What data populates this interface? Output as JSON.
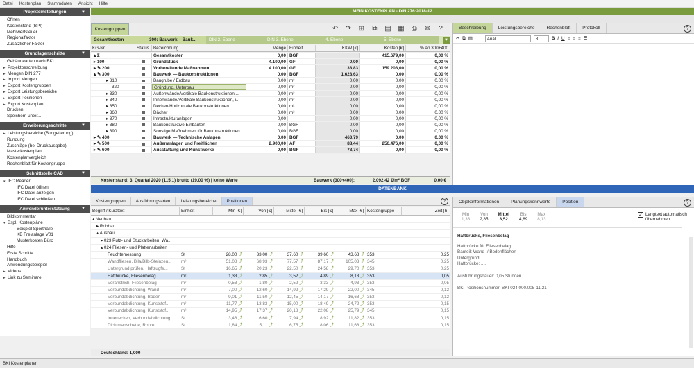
{
  "menu": [
    "Datei",
    "Kostenplan",
    "Stammdaten",
    "Ansicht",
    "Hilfe"
  ],
  "sidebar": [
    {
      "title": "Projekteinstellungen",
      "items": [
        {
          "t": "Öffnen",
          "lvl": 1
        },
        {
          "t": "Kostenstand (BPI)",
          "lvl": 1
        },
        {
          "t": "Mehrwertsteuer",
          "lvl": 1
        },
        {
          "t": "Regionalfaktor",
          "lvl": 1
        },
        {
          "t": "Zusätzlicher Faktor",
          "lvl": 1
        }
      ]
    },
    {
      "title": "Grundlagenschritte",
      "items": [
        {
          "t": "Gebäudearten nach BKI",
          "lvl": 1
        },
        {
          "t": "Projektbeschreibung",
          "lvl": 0,
          "mk": "▸"
        },
        {
          "t": "Mengen DIN 277",
          "lvl": 0,
          "mk": "▸"
        },
        {
          "t": "Import Mengen",
          "lvl": 0,
          "mk": "▸"
        },
        {
          "t": "Export Kostengruppen",
          "lvl": 0,
          "mk": "▸"
        },
        {
          "t": "Export Leistungsbereiche",
          "lvl": 0,
          "mk": "▸"
        },
        {
          "t": "Export Positionen",
          "lvl": 0,
          "mk": "▸"
        },
        {
          "t": "Export Kostenplan",
          "lvl": 0,
          "mk": "▸"
        },
        {
          "t": "Drucken",
          "lvl": 1
        },
        {
          "t": "Speichern unter...",
          "lvl": 1
        }
      ]
    },
    {
      "title": "Erweiterungsschritte",
      "items": [
        {
          "t": "Leistungsbereiche (Budgetierung)",
          "lvl": 0,
          "mk": "▸"
        },
        {
          "t": "Rundung",
          "lvl": 1
        },
        {
          "t": "Zuschläge (bei Druckausgabe)",
          "lvl": 1
        },
        {
          "t": "Masterkostenplan",
          "lvl": 1
        },
        {
          "t": "Kostenplanvergleich",
          "lvl": 1
        },
        {
          "t": "Rechenblatt für Kostengruppe",
          "lvl": 1
        }
      ]
    },
    {
      "title": "Schnittstelle CAD",
      "items": [
        {
          "t": "IFC Reader",
          "lvl": 0,
          "mk": "▾"
        },
        {
          "t": "IFC Datei öffnen",
          "lvl": 2
        },
        {
          "t": "IFC Datei anzeigen",
          "lvl": 2
        },
        {
          "t": "IFC Datei schließen",
          "lvl": 2
        }
      ]
    },
    {
      "title": "Anwenderunterstützung",
      "items": [
        {
          "t": "Bildkommentar",
          "lvl": 1
        },
        {
          "t": "Bspl. Kostenpläne",
          "lvl": 0,
          "mk": "▾"
        },
        {
          "t": "Beispiel Sporthalle",
          "lvl": 2
        },
        {
          "t": "KB Freianlage V01",
          "lvl": 2
        },
        {
          "t": "Musterkosten Büro",
          "lvl": 2
        },
        {
          "t": "Hilfe",
          "lvl": 1
        },
        {
          "t": "Erste Schritte",
          "lvl": 1
        },
        {
          "t": "Handbuch",
          "lvl": 1
        },
        {
          "t": "Anwendungsbeispiel",
          "lvl": 1
        },
        {
          "t": "Videos",
          "lvl": 0,
          "mk": "▸"
        },
        {
          "t": "Link zu Seminare",
          "lvl": 0,
          "mk": "▸"
        }
      ]
    }
  ],
  "title": "MEIN KOSTENPLAN - DIN 276:2018-12",
  "tab_kostengruppen": "Kostengruppen",
  "crumbs": [
    {
      "t": "Gesamtkosten",
      "c": "act"
    },
    {
      "t": "300: Bauwerk – Bauk...",
      "c": "act"
    },
    {
      "t": "DIN 2. Ebene",
      "c": "dim"
    },
    {
      "t": "DIN 3. Ebene",
      "c": "dim"
    },
    {
      "t": "4. Ebene",
      "c": "dim"
    },
    {
      "t": "5. Ebene",
      "c": "dim"
    }
  ],
  "grid_cols": [
    "KG-Nr.",
    "Status",
    "Bezeichnung",
    "Menge",
    "Einheit",
    "KKW [€]",
    "Kosten [€]",
    "% an 300+400"
  ],
  "rows": [
    {
      "kg": "▴ Σ",
      "st": "",
      "bez": "Gesamtkosten",
      "me": "0,00",
      "ei": "BGF",
      "kkw": "",
      "ko": "415.679,00",
      "p": "0,00 %",
      "b": true
    },
    {
      "kg": "▸ 100",
      "st": "■",
      "bez": "Grundstück",
      "me": "4.100,00",
      "ei": "GF",
      "kkw": "0,00",
      "ko": "0,00",
      "p": "0,00 %",
      "b": true
    },
    {
      "kg": "▸ ✎ 200",
      "st": "■",
      "bez": "Vorbereitende Maßnahmen",
      "me": "4.100,00",
      "ei": "GF",
      "kkw": "38,83",
      "ko": "159.203,00",
      "p": "0,00 %",
      "b": true
    },
    {
      "kg": "▴ ✎ 300",
      "st": "■",
      "bez": "Bauwerk — Baukonstruktionen",
      "me": "0,00",
      "ei": "BGF",
      "kkw": "1.628,63",
      "ko": "0,00",
      "p": "0,00 %",
      "b": true
    },
    {
      "kg": "▸ 310",
      "st": "■",
      "bez": "Baugrube / Erdbau",
      "me": "0,00",
      "ei": "m³",
      "kkw": "0,00",
      "ko": "0,00",
      "p": "0,00 %"
    },
    {
      "kg": "320",
      "st": "■",
      "bez": "Gründung, Unterbau",
      "me": "0,00",
      "ei": "m²",
      "kkw": "0,00",
      "ko": "0,00",
      "p": "0,00 %",
      "sel": true
    },
    {
      "kg": "▸ 330",
      "st": "■",
      "bez": "Außenwände/Vertikale Baukonstruktionen,...",
      "me": "0,00",
      "ei": "m²",
      "kkw": "0,00",
      "ko": "0,00",
      "p": "0,00 %"
    },
    {
      "kg": "▸ 340",
      "st": "■",
      "bez": "Innenwände/Vertikale Baukonstruktionen, i...",
      "me": "0,00",
      "ei": "m²",
      "kkw": "0,00",
      "ko": "0,00",
      "p": "0,00 %"
    },
    {
      "kg": "▸ 350",
      "st": "■",
      "bez": "Decken/Horizontale Baukonstruktionen",
      "me": "0,00",
      "ei": "m²",
      "kkw": "0,00",
      "ko": "0,00",
      "p": "0,00 %"
    },
    {
      "kg": "▸ 360",
      "st": "■",
      "bez": "Dächer",
      "me": "0,00",
      "ei": "m²",
      "kkw": "0,00",
      "ko": "0,00",
      "p": "0,00 %"
    },
    {
      "kg": "▸ 370",
      "st": "■",
      "bez": "Infrastrukturanlagen",
      "me": "0,00",
      "ei": "",
      "kkw": "0,00",
      "ko": "0,00",
      "p": "0,00 %"
    },
    {
      "kg": "▸ 380",
      "st": "■",
      "bez": "Baukonstruktive Einbauten",
      "me": "0,00",
      "ei": "BGF",
      "kkw": "0,00",
      "ko": "0,00",
      "p": "0,00 %"
    },
    {
      "kg": "▸ 390",
      "st": "■",
      "bez": "Sonstige Maßnahmen für Baukonstruktionen",
      "me": "0,00",
      "ei": "BGF",
      "kkw": "0,00",
      "ko": "0,00",
      "p": "0,00 %"
    },
    {
      "kg": "▸ ✎ 400",
      "st": "■",
      "bez": "Bauwerk — Technische Anlagen",
      "me": "0,00",
      "ei": "BGF",
      "kkw": "463,79",
      "ko": "0,00",
      "p": "0,00 %",
      "b": true
    },
    {
      "kg": "▸ ✎ 500",
      "st": "■",
      "bez": "Außenanlagen und Freiflächen",
      "me": "2.900,00",
      "ei": "AF",
      "kkw": "88,44",
      "ko": "256.476,00",
      "p": "0,00 %",
      "b": true
    },
    {
      "kg": "▸ ✎ 600",
      "st": "■",
      "bez": "Ausstattung und Kunstwerke",
      "me": "0,00",
      "ei": "BGF",
      "kkw": "78,74",
      "ko": "0,00",
      "p": "0,00 %",
      "b": true
    }
  ],
  "footer": {
    "left": "Kostenstand: 3. Quartal 2020 (115,1) brutto (19,00 %) | keine Werte",
    "mid": "Bauwerk (300+400):",
    "val": "2.092,42 €/m² BGF",
    "right": "0,00 €"
  },
  "rtabs": [
    "Beschreibung",
    "Leistungsbereiche",
    "Rechenblatt",
    "Protokoll"
  ],
  "font": "Arial",
  "size": "8",
  "datenbank": "DATENBANK",
  "btabs": [
    "Kostengruppen",
    "Ausführungsarten",
    "Leistungsbereiche",
    "Positionen"
  ],
  "bcols": [
    "Begriff / Kurztext",
    "Einheit",
    "Min [€]",
    "Von [€]",
    "Mittel [€]",
    "Bis [€]",
    "Max [€]",
    "Kostengruppe",
    "Zeit [h]"
  ],
  "brows": [
    {
      "n": "▴ Neubau",
      "pad": 2
    },
    {
      "n": "▸ Rohbau",
      "pad": 8
    },
    {
      "n": "▴ Ausbau",
      "pad": 8
    },
    {
      "n": "▸ 023 Putz- und Stuckarbeiten, Wa...",
      "pad": 14
    },
    {
      "n": "▴ 024 Fliesen- und Plattenarbeiten",
      "pad": 14
    },
    {
      "n": "Feuchtemessung",
      "pad": 24,
      "e": "St",
      "mi": "28,00",
      "vo": "33,00",
      "mt": "37,60",
      "bi": "39,60",
      "ma": "43,68",
      "kg": "353",
      "z": "0,25"
    },
    {
      "n": "Wandfliesen, Bila/Bilb-Steinzeu...",
      "pad": 24,
      "e": "m²",
      "mi": "51,08",
      "vo": "68,93",
      "mt": "77,57",
      "bi": "87,17",
      "ma": "105,03",
      "kg": "345",
      "z": "0,25",
      "g": true
    },
    {
      "n": "Untergrund prüfen, Haftzugfe...",
      "pad": 24,
      "e": "St",
      "mi": "16,65",
      "vo": "20,23",
      "mt": "22,50",
      "bi": "24,58",
      "ma": "29,70",
      "kg": "353",
      "z": "0,25",
      "g": true
    },
    {
      "n": "Haftbrücke, Fliesenbelag",
      "pad": 24,
      "e": "m²",
      "mi": "1,33",
      "vo": "2,85",
      "mt": "3,52",
      "bi": "4,89",
      "ma": "8,13",
      "kg": "353",
      "z": "0,05",
      "hl": true
    },
    {
      "n": "Voranstrich, Fliesenbelag",
      "pad": 24,
      "e": "m²",
      "mi": "0,53",
      "vo": "1,80",
      "mt": "2,52",
      "bi": "3,33",
      "ma": "4,93",
      "kg": "353",
      "z": "0,05",
      "g": true
    },
    {
      "n": "Verbundabdichtung, Wand",
      "pad": 24,
      "e": "m²",
      "mi": "7,00",
      "vo": "12,60",
      "mt": "14,92",
      "bi": "17,29",
      "ma": "22,00",
      "kg": "345",
      "z": "0,12",
      "g": true
    },
    {
      "n": "Verbundabdichtung, Boden",
      "pad": 24,
      "e": "m²",
      "mi": "9,01",
      "vo": "11,50",
      "mt": "12,45",
      "bi": "14,17",
      "ma": "16,68",
      "kg": "353",
      "z": "0,12",
      "g": true
    },
    {
      "n": "Verbundabdichtung, Kunststof...",
      "pad": 24,
      "e": "m²",
      "mi": "11,77",
      "vo": "13,83",
      "mt": "15,00",
      "bi": "18,49",
      "ma": "24,72",
      "kg": "353",
      "z": "0,15",
      "g": true
    },
    {
      "n": "Verbundabdichtung, Kunststof...",
      "pad": 24,
      "e": "m²",
      "mi": "14,95",
      "vo": "17,37",
      "mt": "20,18",
      "bi": "22,08",
      "ma": "25,79",
      "kg": "345",
      "z": "0,15",
      "g": true
    },
    {
      "n": "Innenecken, Verbundabdichtung",
      "pad": 24,
      "e": "St",
      "mi": "3,48",
      "vo": "6,60",
      "mt": "7,94",
      "bi": "8,92",
      "ma": "11,82",
      "kg": "353",
      "z": "0,15",
      "g": true
    },
    {
      "n": "Dichtmanschette, Rohre",
      "pad": 24,
      "e": "St",
      "mi": "1,84",
      "vo": "5,11",
      "mt": "6,75",
      "bi": "8,06",
      "ma": "11,68",
      "kg": "353",
      "z": "0,15",
      "g": true
    }
  ],
  "bfoot": "Deutschland: 1,000",
  "brtabs": [
    "Objektinformationen",
    "Planungskennwerte",
    "Position"
  ],
  "stats": [
    {
      "l": "Min",
      "v": "1,33"
    },
    {
      "l": "Von",
      "v": "2,85"
    },
    {
      "l": "Mittel",
      "v": "3,52",
      "act": true
    },
    {
      "l": "Bis",
      "v": "4,89"
    },
    {
      "l": "Max",
      "v": "8,13"
    }
  ],
  "langtext": "Langtext automatisch übernehmen",
  "desc_title": "Haftbrücke, Fliesenbelag",
  "desc_lines": [
    "Haftbrücke für Fliesenbelag.",
    "Bauteil: Wand- / Bodenflächen",
    "Untergrund: ....",
    "Haftbrücke: ....",
    "",
    "Ausführungsdauer: 0,05 Stunden",
    "",
    "BKI Positionsnummer: BKI-024.000.005-11.21"
  ],
  "status": "BKI Kostenplaner"
}
